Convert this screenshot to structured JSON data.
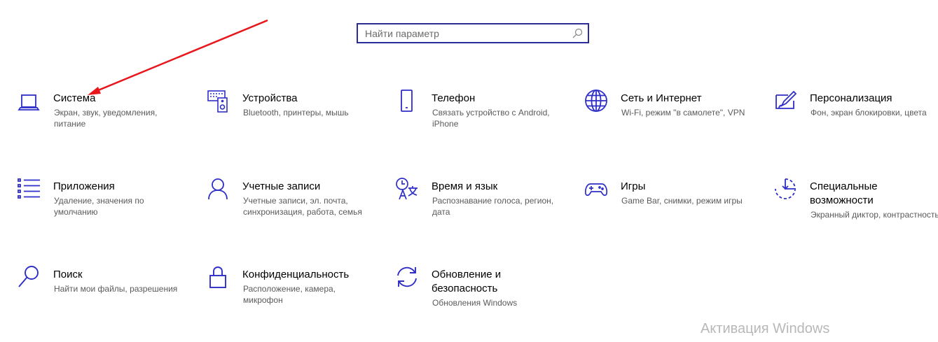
{
  "search": {
    "placeholder": "Найти параметр"
  },
  "tiles": [
    {
      "title": "Система",
      "desc": "Экран, звук, уведомления, питание"
    },
    {
      "title": "Устройства",
      "desc": "Bluetooth, принтеры, мышь"
    },
    {
      "title": "Телефон",
      "desc": "Связать устройство с Android, iPhone"
    },
    {
      "title": "Сеть и Интернет",
      "desc": "Wi-Fi, режим \"в самолете\", VPN"
    },
    {
      "title": "Персонализация",
      "desc": "Фон, экран блокировки, цвета"
    },
    {
      "title": "Приложения",
      "desc": "Удаление, значения по умолчанию"
    },
    {
      "title": "Учетные записи",
      "desc": "Учетные записи, эл. почта, синхронизация, работа, семья"
    },
    {
      "title": "Время и язык",
      "desc": "Распознавание голоса, регион, дата"
    },
    {
      "title": "Игры",
      "desc": "Game Bar, снимки, режим игры"
    },
    {
      "title": "Специальные возможности",
      "desc": "Экранный диктор, контрастность"
    },
    {
      "title": "Поиск",
      "desc": "Найти мои файлы, разрешения"
    },
    {
      "title": "Конфиденциальность",
      "desc": "Расположение, камера, микрофон"
    },
    {
      "title": "Обновление и безопасность",
      "desc": "Обновления Windows"
    }
  ],
  "watermark": "Активация Windows",
  "colors": {
    "accent": "#2b2b9a",
    "icon": "#2e2ec8",
    "annotation_arrow": "#e8151b"
  },
  "icons": [
    "laptop-icon",
    "keyboard-speaker-icon",
    "phone-icon",
    "globe-icon",
    "paint-icon",
    "apps-list-icon",
    "person-icon",
    "time-language-icon",
    "gamepad-icon",
    "accessibility-icon",
    "search-icon",
    "lock-icon",
    "sync-icon"
  ]
}
